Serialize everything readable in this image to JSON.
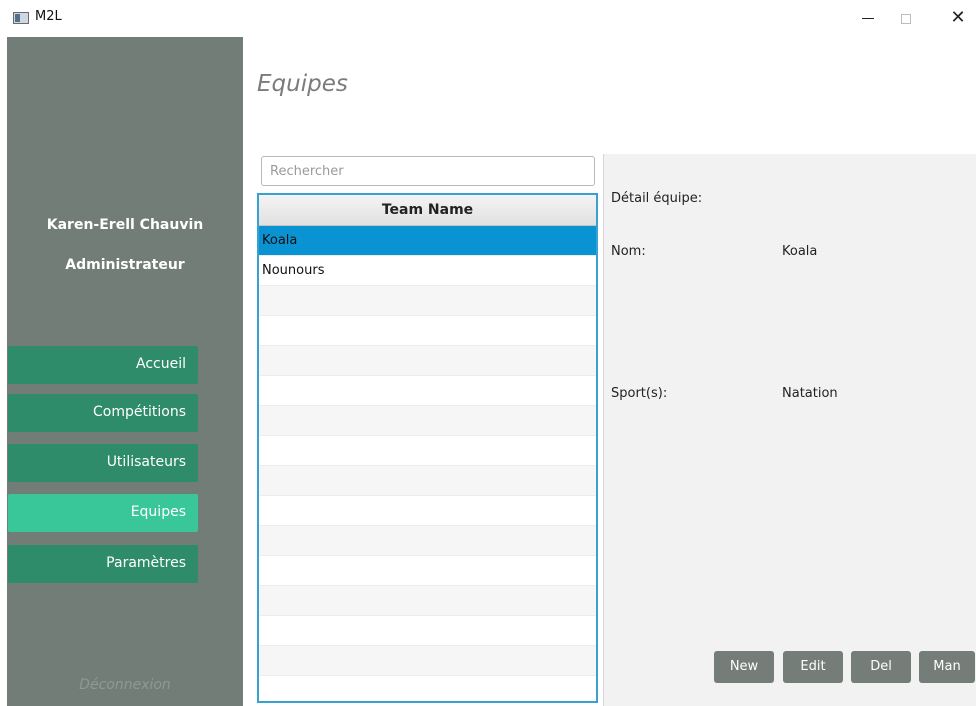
{
  "window": {
    "title": "M2L",
    "icon": "app-window-icon",
    "min_glyph": "",
    "close_glyph": "✕"
  },
  "sidebar": {
    "user_name": "Karen-Erell Chauvin",
    "user_role": "Administrateur",
    "nav": [
      {
        "label": "Accueil",
        "active": false
      },
      {
        "label": "Compétitions",
        "active": false
      },
      {
        "label": "Utilisateurs",
        "active": false
      },
      {
        "label": "Equipes",
        "active": true
      },
      {
        "label": "Paramètres",
        "active": false
      }
    ],
    "logout_label": "Déconnexion"
  },
  "main": {
    "title": "Equipes",
    "search": {
      "placeholder": "Rechercher",
      "value": ""
    },
    "table": {
      "column_header": "Team Name",
      "rows": [
        "Koala",
        "Nounours",
        "",
        "",
        "",
        "",
        "",
        "",
        "",
        "",
        "",
        "",
        "",
        "",
        "",
        ""
      ],
      "selected_index": 0
    },
    "detail": {
      "heading": "Détail équipe:",
      "name_label": "Nom:",
      "name_value": "Koala",
      "sport_label": "Sport(s):",
      "sport_value": "Natation"
    },
    "actions": {
      "new_label": "New",
      "edit_label": "Edit",
      "del_label": "Del",
      "man_label": "Man"
    }
  },
  "colors": {
    "sidebar_bg": "#737d78",
    "nav_button": "#2e8c6a",
    "nav_button_active": "#39c79a",
    "selection": "#0a93d3",
    "table_border": "#3aa0cf",
    "action_button": "#747d78"
  }
}
